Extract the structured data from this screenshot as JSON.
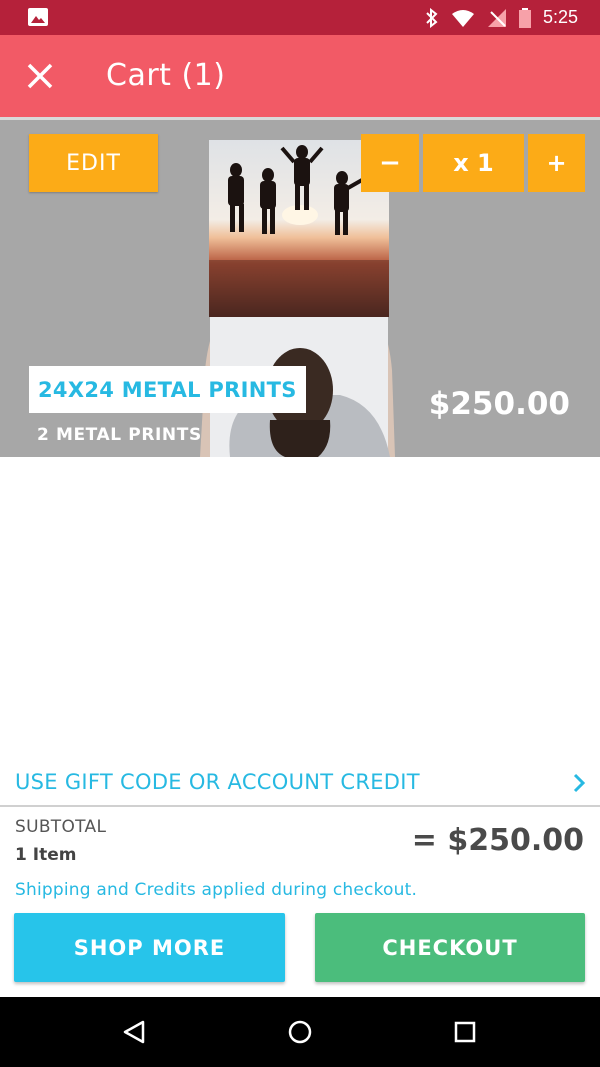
{
  "status_bar": {
    "time": "5:25",
    "icons": [
      "gallery-icon",
      "bluetooth-icon",
      "wifi-icon",
      "no-signal-icon",
      "battery-icon"
    ]
  },
  "app_bar": {
    "title": "Cart (1)",
    "close_icon": "close-icon",
    "color": "#f25a66"
  },
  "cart_item": {
    "edit_label": "EDIT",
    "decrement_label": "−",
    "quantity_label": "x 1",
    "increment_label": "+",
    "product_name": "24X24 METAL PRINTS",
    "product_sub": "2 METAL PRINTS",
    "price": "$250.00"
  },
  "gift_code": {
    "label": "USE GIFT CODE OR ACCOUNT CREDIT",
    "icon": "chevron-right-icon"
  },
  "summary": {
    "subtotal_label": "SUBTOTAL",
    "item_count": "1 Item",
    "subtotal_value": "= $250.00",
    "shipping_note": "Shipping and Credits applied during checkout."
  },
  "actions": {
    "shop_more_label": "SHOP MORE",
    "checkout_label": "CHECKOUT"
  },
  "colors": {
    "accent_orange": "#fcab17",
    "accent_blue": "#27b9e2",
    "checkout_green": "#4bbd7c",
    "status_bar": "#b5213a"
  },
  "nav_bar": {
    "icons": [
      "back-icon",
      "home-icon",
      "recents-icon"
    ]
  }
}
